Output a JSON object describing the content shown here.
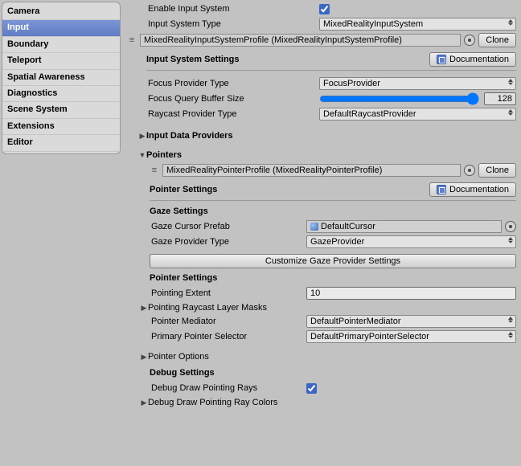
{
  "sidebar": {
    "items": [
      {
        "label": "Camera"
      },
      {
        "label": "Input"
      },
      {
        "label": "Boundary"
      },
      {
        "label": "Teleport"
      },
      {
        "label": "Spatial Awareness"
      },
      {
        "label": "Diagnostics"
      },
      {
        "label": "Scene System"
      },
      {
        "label": "Extensions"
      },
      {
        "label": "Editor"
      }
    ],
    "selected": "Input"
  },
  "main": {
    "enable_input_label": "Enable Input System",
    "enable_input_checked": true,
    "input_system_type_label": "Input System Type",
    "input_system_type_value": "MixedRealityInputSystem",
    "profile_value": "MixedRealityInputSystemProfile (MixedRealityInputSystemProfile)",
    "clone_label": "Clone",
    "input_settings_title": "Input System Settings",
    "documentation_label": "Documentation",
    "focus_provider_label": "Focus Provider Type",
    "focus_provider_value": "FocusProvider",
    "focus_buffer_label": "Focus Query Buffer Size",
    "focus_buffer_value": "128",
    "raycast_provider_label": "Raycast Provider Type",
    "raycast_provider_value": "DefaultRaycastProvider",
    "input_data_providers_title": "Input Data Providers",
    "pointers_title": "Pointers",
    "pointers": {
      "profile_value": "MixedRealityPointerProfile (MixedRealityPointerProfile)",
      "settings_title": "Pointer Settings",
      "gaze_title": "Gaze Settings",
      "gaze_cursor_label": "Gaze Cursor Prefab",
      "gaze_cursor_value": "DefaultCursor",
      "gaze_provider_label": "Gaze Provider Type",
      "gaze_provider_value": "GazeProvider",
      "customize_gaze_btn": "Customize Gaze Provider Settings",
      "pointer_settings2_title": "Pointer Settings",
      "pointing_extent_label": "Pointing Extent",
      "pointing_extent_value": "10",
      "raycast_masks_title": "Pointing Raycast Layer Masks",
      "mediator_label": "Pointer Mediator",
      "mediator_value": "DefaultPointerMediator",
      "primary_selector_label": "Primary Pointer Selector",
      "primary_selector_value": "DefaultPrimaryPointerSelector",
      "options_title": "Pointer Options",
      "debug_title": "Debug Settings",
      "debug_draw_rays_label": "Debug Draw Pointing Rays",
      "debug_draw_rays_checked": true,
      "debug_draw_colors_title": "Debug Draw Pointing Ray Colors"
    }
  }
}
